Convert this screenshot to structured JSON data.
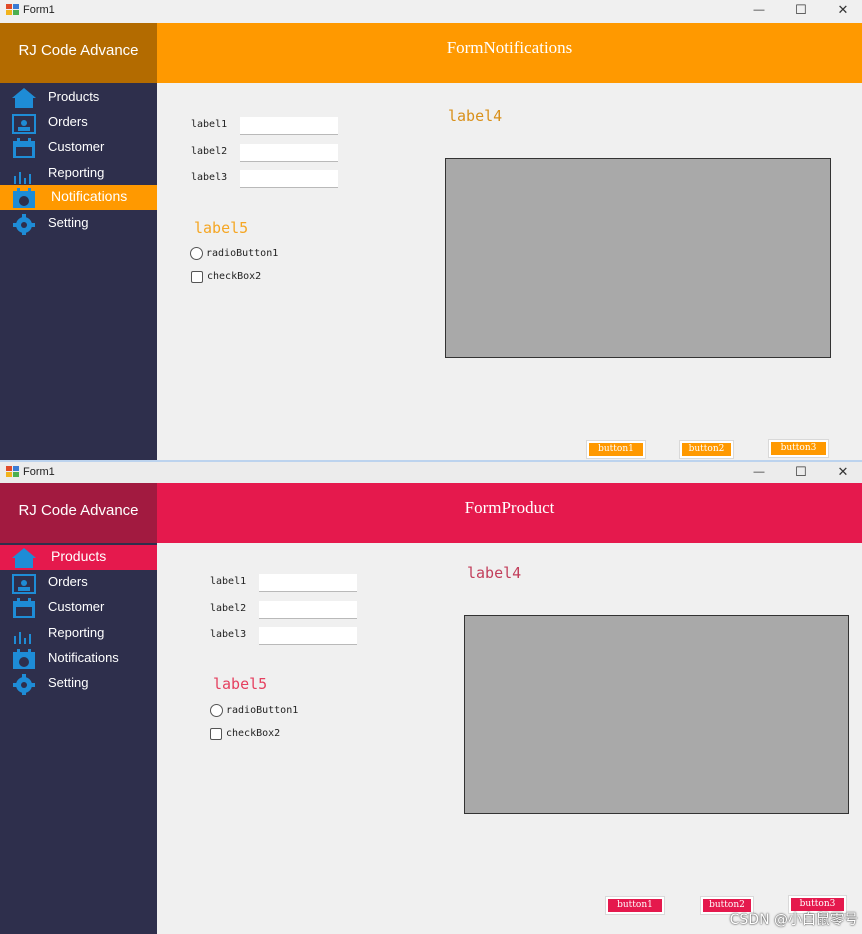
{
  "colors": {
    "sidebar_bg": "#2e2f4c",
    "icon_blue": "#1e8cd6",
    "orange": "#ff9900",
    "orange_logo": "#b36b00",
    "orange_text": "#d9901a",
    "red": "#e5194d",
    "red_logo": "#a21a40",
    "red_text": "#e5194d"
  },
  "windows": [
    {
      "title": "Form1",
      "theme": "orange",
      "logo": "RJ Code Advance",
      "header_title": "FormNotifications",
      "nav": [
        {
          "label": "Products",
          "icon": "home-icon"
        },
        {
          "label": "Orders",
          "icon": "orders-icon"
        },
        {
          "label": "Customer",
          "icon": "calendar-icon"
        },
        {
          "label": "Reporting",
          "icon": "bar-chart-icon"
        },
        {
          "label": "Notifications",
          "icon": "calendar-clock-icon",
          "active": true
        },
        {
          "label": "Setting",
          "icon": "gear-icon"
        }
      ],
      "form": {
        "label1": "label1",
        "label2": "label2",
        "label3": "label3",
        "label4": "label4",
        "label5": "label5",
        "radio": "radioButton1",
        "checkbox": "checkBox2",
        "button1": "button1",
        "button2": "button2",
        "button3": "button3"
      }
    },
    {
      "title": "Form1",
      "theme": "red",
      "logo": "RJ Code Advance",
      "header_title": "FormProduct",
      "nav": [
        {
          "label": "Products",
          "icon": "home-icon",
          "active": true
        },
        {
          "label": "Orders",
          "icon": "orders-icon"
        },
        {
          "label": "Customer",
          "icon": "calendar-icon"
        },
        {
          "label": "Reporting",
          "icon": "bar-chart-icon"
        },
        {
          "label": "Notifications",
          "icon": "calendar-clock-icon"
        },
        {
          "label": "Setting",
          "icon": "gear-icon"
        }
      ],
      "form": {
        "label1": "label1",
        "label2": "label2",
        "label3": "label3",
        "label4": "label4",
        "label5": "label5",
        "radio": "radioButton1",
        "checkbox": "checkBox2",
        "button1": "button1",
        "button2": "button2",
        "button3": "button3"
      }
    }
  ],
  "window_controls": {
    "minimize": "—",
    "maximize": "☐",
    "close": "✕"
  },
  "watermark": "CSDN @小白鼠零号"
}
